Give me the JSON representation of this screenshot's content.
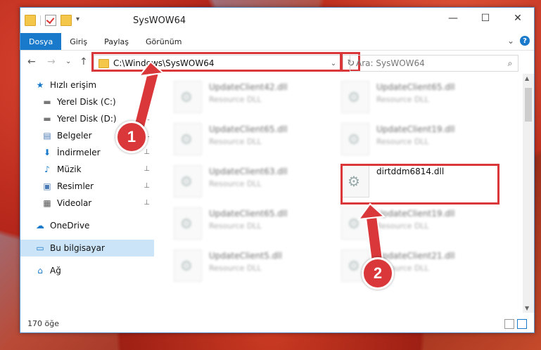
{
  "window": {
    "title": "SysWOW64",
    "controls": {
      "minimize": "—",
      "maximize": "☐",
      "close": "✕"
    }
  },
  "ribbon": {
    "tabs": [
      "Dosya",
      "Giriş",
      "Paylaş",
      "Görünüm"
    ],
    "expand_glyph": "⌄",
    "help": "?"
  },
  "navigation": {
    "back": "←",
    "forward": "→",
    "recent": "⌄",
    "up": "↑",
    "address": "C:\\Windows\\SysWOW64",
    "address_dropdown": "⌄",
    "refresh": "↻",
    "search_placeholder": "Ara: SysWOW64",
    "search_icon": "⌕"
  },
  "sidebar": {
    "items": [
      {
        "label": "Hızlı erişim",
        "icon": "star-icon",
        "glyph": "★",
        "pinned": false
      },
      {
        "label": "Yerel Disk (C:)",
        "icon": "drive-icon",
        "glyph": "▬",
        "pinned": true
      },
      {
        "label": "Yerel Disk (D:)",
        "icon": "drive-icon",
        "glyph": "▬",
        "pinned": true
      },
      {
        "label": "Belgeler",
        "icon": "document-icon",
        "glyph": "▤",
        "pinned": true
      },
      {
        "label": "İndirmeler",
        "icon": "download-icon",
        "glyph": "⬇",
        "pinned": true
      },
      {
        "label": "Müzik",
        "icon": "music-icon",
        "glyph": "♪",
        "pinned": true
      },
      {
        "label": "Resimler",
        "icon": "pictures-icon",
        "glyph": "▣",
        "pinned": true
      },
      {
        "label": "Videolar",
        "icon": "video-icon",
        "glyph": "▦",
        "pinned": true
      },
      {
        "label": "OneDrive",
        "icon": "cloud-icon",
        "glyph": "☁",
        "pinned": false
      },
      {
        "label": "Bu bilgisayar",
        "icon": "computer-icon",
        "glyph": "▭",
        "pinned": false
      },
      {
        "label": "Ağ",
        "icon": "network-icon",
        "glyph": "⌂",
        "pinned": false
      }
    ],
    "pin_glyph": "📌"
  },
  "files": [
    {
      "name": "UpdateClient42.dll",
      "type": "Resource DLL",
      "blurred": true
    },
    {
      "name": "UpdateClient65.dll",
      "type": "Resource DLL",
      "blurred": true
    },
    {
      "name": "UpdateClient65.dll",
      "type": "Resource DLL",
      "blurred": true
    },
    {
      "name": "UpdateClient19.dll",
      "type": "Resource DLL",
      "blurred": true
    },
    {
      "name": "UpdateClient63.dll",
      "type": "Resource DLL",
      "blurred": true
    },
    {
      "name": "dirtddm6814.dll",
      "type": "",
      "blurred": false
    },
    {
      "name": "UpdateClient65.dll",
      "type": "Resource DLL",
      "blurred": true
    },
    {
      "name": "UpdateClient19.dll",
      "type": "Resource DLL",
      "blurred": true
    },
    {
      "name": "UpdateClient5.dll",
      "type": "Resource DLL",
      "blurred": true
    },
    {
      "name": "UpdateClient21.dll",
      "type": "Resource DLL",
      "blurred": true
    }
  ],
  "status": {
    "count": "170 öğe"
  },
  "annotations": {
    "step1": "1",
    "step2": "2"
  },
  "colors": {
    "accent": "#1979ca",
    "highlight": "#d9373a",
    "selection": "#cce4f7"
  }
}
